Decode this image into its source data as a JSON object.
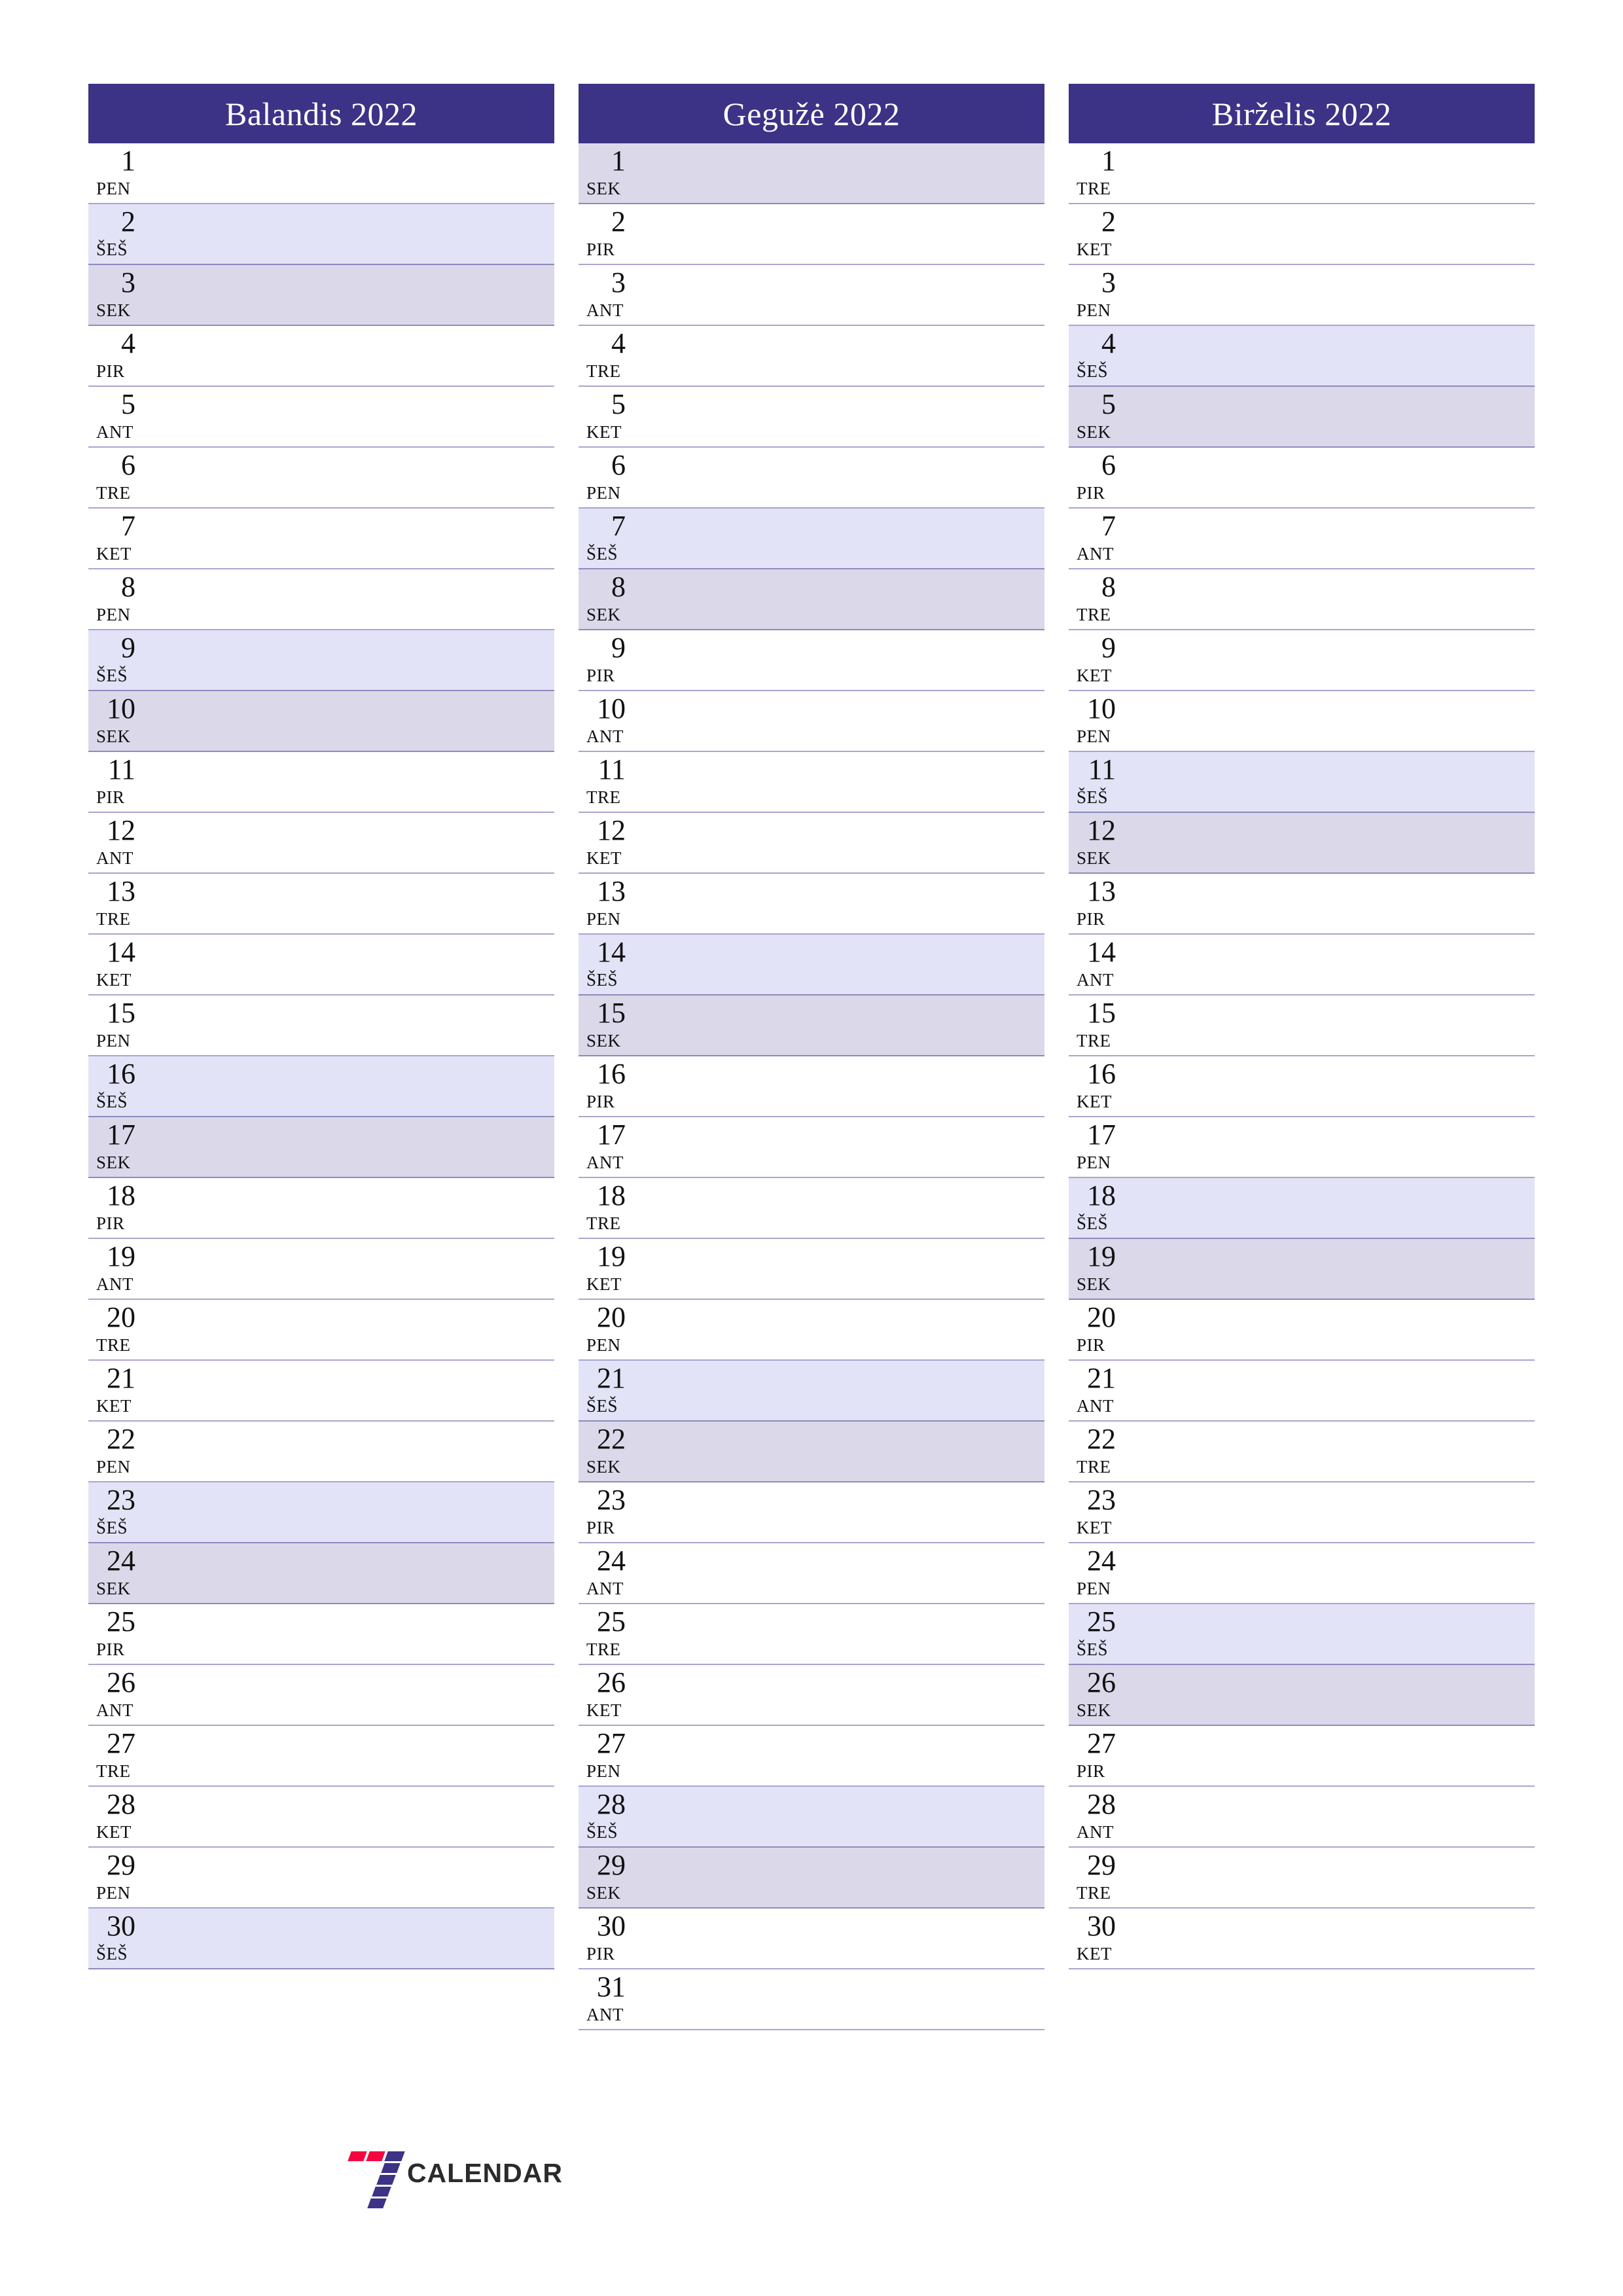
{
  "document": {
    "kind": "printable-planner",
    "year": "2022",
    "language": "lt",
    "logo": {
      "mark": "seven-icon",
      "text": "CALENDAR"
    }
  },
  "colors": {
    "header_bg": "#3c3286",
    "header_text": "#ffffff",
    "saturday_bg": "#e3e3f7",
    "sunday_bg": "#dbd8ea",
    "rule": "#9d9ac9",
    "logo_red": "#f5053f",
    "logo_purple": "#3c3286",
    "logo_text": "#2b2b2b",
    "page_bg": "#ffffff"
  },
  "months": [
    {
      "title": "Balandis 2022",
      "days": [
        {
          "num": "1",
          "wd": "PEN",
          "type": "weekday"
        },
        {
          "num": "2",
          "wd": "ŠEŠ",
          "type": "sat"
        },
        {
          "num": "3",
          "wd": "SEK",
          "type": "sun"
        },
        {
          "num": "4",
          "wd": "PIR",
          "type": "weekday"
        },
        {
          "num": "5",
          "wd": "ANT",
          "type": "weekday"
        },
        {
          "num": "6",
          "wd": "TRE",
          "type": "weekday"
        },
        {
          "num": "7",
          "wd": "KET",
          "type": "weekday"
        },
        {
          "num": "8",
          "wd": "PEN",
          "type": "weekday"
        },
        {
          "num": "9",
          "wd": "ŠEŠ",
          "type": "sat"
        },
        {
          "num": "10",
          "wd": "SEK",
          "type": "sun"
        },
        {
          "num": "11",
          "wd": "PIR",
          "type": "weekday"
        },
        {
          "num": "12",
          "wd": "ANT",
          "type": "weekday"
        },
        {
          "num": "13",
          "wd": "TRE",
          "type": "weekday"
        },
        {
          "num": "14",
          "wd": "KET",
          "type": "weekday"
        },
        {
          "num": "15",
          "wd": "PEN",
          "type": "weekday"
        },
        {
          "num": "16",
          "wd": "ŠEŠ",
          "type": "sat"
        },
        {
          "num": "17",
          "wd": "SEK",
          "type": "sun"
        },
        {
          "num": "18",
          "wd": "PIR",
          "type": "weekday"
        },
        {
          "num": "19",
          "wd": "ANT",
          "type": "weekday"
        },
        {
          "num": "20",
          "wd": "TRE",
          "type": "weekday"
        },
        {
          "num": "21",
          "wd": "KET",
          "type": "weekday"
        },
        {
          "num": "22",
          "wd": "PEN",
          "type": "weekday"
        },
        {
          "num": "23",
          "wd": "ŠEŠ",
          "type": "sat"
        },
        {
          "num": "24",
          "wd": "SEK",
          "type": "sun"
        },
        {
          "num": "25",
          "wd": "PIR",
          "type": "weekday"
        },
        {
          "num": "26",
          "wd": "ANT",
          "type": "weekday"
        },
        {
          "num": "27",
          "wd": "TRE",
          "type": "weekday"
        },
        {
          "num": "28",
          "wd": "KET",
          "type": "weekday"
        },
        {
          "num": "29",
          "wd": "PEN",
          "type": "weekday"
        },
        {
          "num": "30",
          "wd": "ŠEŠ",
          "type": "sat"
        }
      ]
    },
    {
      "title": "Gegužė 2022",
      "days": [
        {
          "num": "1",
          "wd": "SEK",
          "type": "sun"
        },
        {
          "num": "2",
          "wd": "PIR",
          "type": "weekday"
        },
        {
          "num": "3",
          "wd": "ANT",
          "type": "weekday"
        },
        {
          "num": "4",
          "wd": "TRE",
          "type": "weekday"
        },
        {
          "num": "5",
          "wd": "KET",
          "type": "weekday"
        },
        {
          "num": "6",
          "wd": "PEN",
          "type": "weekday"
        },
        {
          "num": "7",
          "wd": "ŠEŠ",
          "type": "sat"
        },
        {
          "num": "8",
          "wd": "SEK",
          "type": "sun"
        },
        {
          "num": "9",
          "wd": "PIR",
          "type": "weekday"
        },
        {
          "num": "10",
          "wd": "ANT",
          "type": "weekday"
        },
        {
          "num": "11",
          "wd": "TRE",
          "type": "weekday"
        },
        {
          "num": "12",
          "wd": "KET",
          "type": "weekday"
        },
        {
          "num": "13",
          "wd": "PEN",
          "type": "weekday"
        },
        {
          "num": "14",
          "wd": "ŠEŠ",
          "type": "sat"
        },
        {
          "num": "15",
          "wd": "SEK",
          "type": "sun"
        },
        {
          "num": "16",
          "wd": "PIR",
          "type": "weekday"
        },
        {
          "num": "17",
          "wd": "ANT",
          "type": "weekday"
        },
        {
          "num": "18",
          "wd": "TRE",
          "type": "weekday"
        },
        {
          "num": "19",
          "wd": "KET",
          "type": "weekday"
        },
        {
          "num": "20",
          "wd": "PEN",
          "type": "weekday"
        },
        {
          "num": "21",
          "wd": "ŠEŠ",
          "type": "sat"
        },
        {
          "num": "22",
          "wd": "SEK",
          "type": "sun"
        },
        {
          "num": "23",
          "wd": "PIR",
          "type": "weekday"
        },
        {
          "num": "24",
          "wd": "ANT",
          "type": "weekday"
        },
        {
          "num": "25",
          "wd": "TRE",
          "type": "weekday"
        },
        {
          "num": "26",
          "wd": "KET",
          "type": "weekday"
        },
        {
          "num": "27",
          "wd": "PEN",
          "type": "weekday"
        },
        {
          "num": "28",
          "wd": "ŠEŠ",
          "type": "sat"
        },
        {
          "num": "29",
          "wd": "SEK",
          "type": "sun"
        },
        {
          "num": "30",
          "wd": "PIR",
          "type": "weekday"
        },
        {
          "num": "31",
          "wd": "ANT",
          "type": "weekday"
        }
      ]
    },
    {
      "title": "Birželis 2022",
      "days": [
        {
          "num": "1",
          "wd": "TRE",
          "type": "weekday"
        },
        {
          "num": "2",
          "wd": "KET",
          "type": "weekday"
        },
        {
          "num": "3",
          "wd": "PEN",
          "type": "weekday"
        },
        {
          "num": "4",
          "wd": "ŠEŠ",
          "type": "sat"
        },
        {
          "num": "5",
          "wd": "SEK",
          "type": "sun"
        },
        {
          "num": "6",
          "wd": "PIR",
          "type": "weekday"
        },
        {
          "num": "7",
          "wd": "ANT",
          "type": "weekday"
        },
        {
          "num": "8",
          "wd": "TRE",
          "type": "weekday"
        },
        {
          "num": "9",
          "wd": "KET",
          "type": "weekday"
        },
        {
          "num": "10",
          "wd": "PEN",
          "type": "weekday"
        },
        {
          "num": "11",
          "wd": "ŠEŠ",
          "type": "sat"
        },
        {
          "num": "12",
          "wd": "SEK",
          "type": "sun"
        },
        {
          "num": "13",
          "wd": "PIR",
          "type": "weekday"
        },
        {
          "num": "14",
          "wd": "ANT",
          "type": "weekday"
        },
        {
          "num": "15",
          "wd": "TRE",
          "type": "weekday"
        },
        {
          "num": "16",
          "wd": "KET",
          "type": "weekday"
        },
        {
          "num": "17",
          "wd": "PEN",
          "type": "weekday"
        },
        {
          "num": "18",
          "wd": "ŠEŠ",
          "type": "sat"
        },
        {
          "num": "19",
          "wd": "SEK",
          "type": "sun"
        },
        {
          "num": "20",
          "wd": "PIR",
          "type": "weekday"
        },
        {
          "num": "21",
          "wd": "ANT",
          "type": "weekday"
        },
        {
          "num": "22",
          "wd": "TRE",
          "type": "weekday"
        },
        {
          "num": "23",
          "wd": "KET",
          "type": "weekday"
        },
        {
          "num": "24",
          "wd": "PEN",
          "type": "weekday"
        },
        {
          "num": "25",
          "wd": "ŠEŠ",
          "type": "sat"
        },
        {
          "num": "26",
          "wd": "SEK",
          "type": "sun"
        },
        {
          "num": "27",
          "wd": "PIR",
          "type": "weekday"
        },
        {
          "num": "28",
          "wd": "ANT",
          "type": "weekday"
        },
        {
          "num": "29",
          "wd": "TRE",
          "type": "weekday"
        },
        {
          "num": "30",
          "wd": "KET",
          "type": "weekday"
        }
      ]
    }
  ]
}
